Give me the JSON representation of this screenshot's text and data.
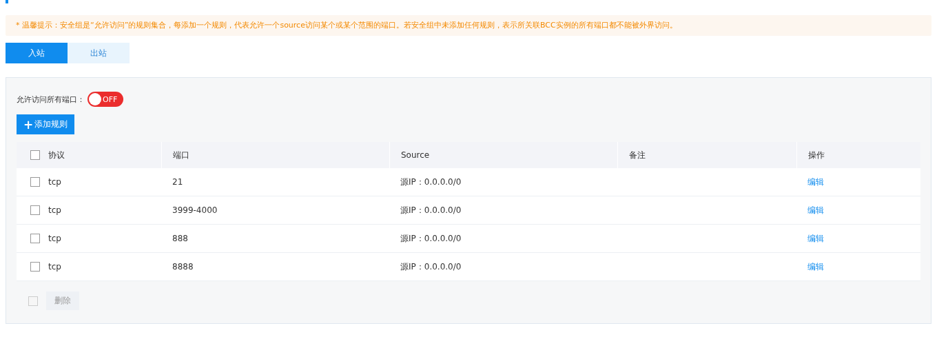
{
  "notice": "* 温馨提示：安全组是“允许访问”的规则集合，每添加一个规则，代表允许一个source访问某个或某个范围的端口。若安全组中未添加任何规则，表示所关联BCC实例的所有端口都不能被外界访问。",
  "tabs": [
    {
      "label": "入站",
      "selected": true
    },
    {
      "label": "出站",
      "selected": false
    }
  ],
  "allow_all": {
    "label": "允许访问所有端口：",
    "on": false,
    "state_text": "OFF"
  },
  "add_button": {
    "icon": "+",
    "label": "添加规则"
  },
  "table": {
    "columns": [
      "协议",
      "端口",
      "Source",
      "备注",
      "操作"
    ],
    "select_all": false,
    "rows": [
      {
        "selected": false,
        "protocol": "tcp",
        "port": "21",
        "source": "源IP：0.0.0.0/0",
        "note": "",
        "action": "编辑"
      },
      {
        "selected": false,
        "protocol": "tcp",
        "port": "3999-4000",
        "source": "源IP：0.0.0.0/0",
        "note": "",
        "action": "编辑"
      },
      {
        "selected": false,
        "protocol": "tcp",
        "port": "888",
        "source": "源IP：0.0.0.0/0",
        "note": "",
        "action": "编辑"
      },
      {
        "selected": false,
        "protocol": "tcp",
        "port": "8888",
        "source": "源IP：0.0.0.0/0",
        "note": "",
        "action": "编辑"
      }
    ]
  },
  "footer": {
    "checked": false,
    "delete_label": "删除",
    "delete_disabled": true
  }
}
